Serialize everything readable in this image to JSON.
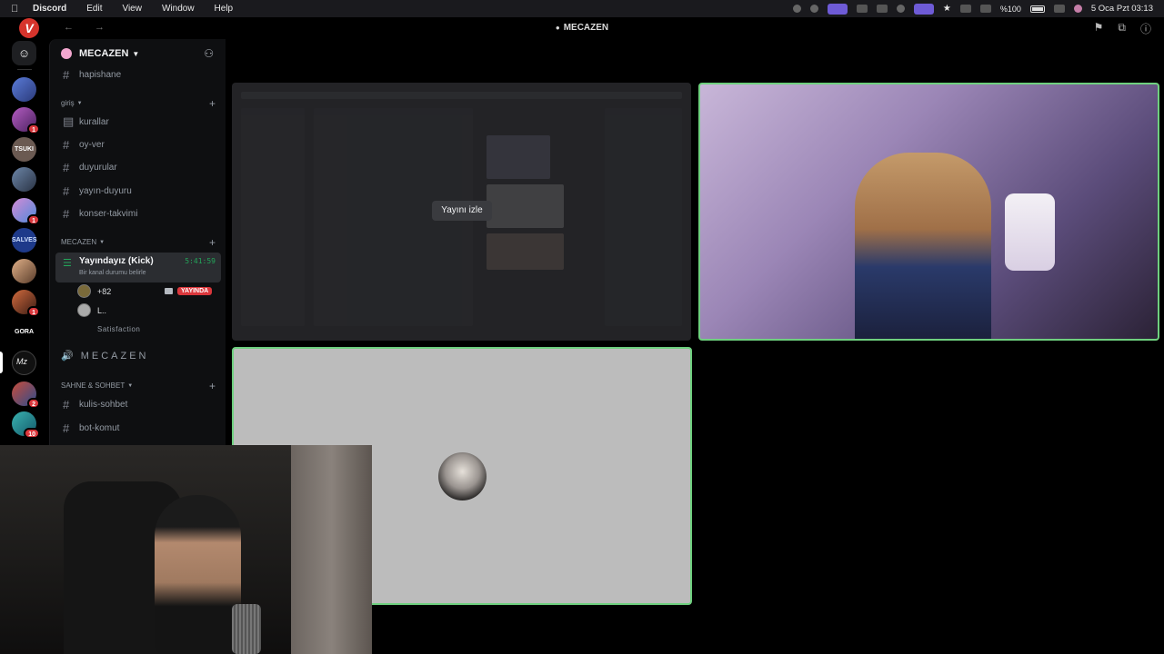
{
  "menubar": {
    "app": "Discord",
    "items": [
      "Edit",
      "View",
      "Window",
      "Help"
    ],
    "battery": "%100",
    "datetime": "5 Oca Pzt  03:13"
  },
  "titlebar": {
    "title": "MECAZEN"
  },
  "rail": {
    "servers": [
      {
        "label": "",
        "badge": ""
      },
      {
        "label": "",
        "badge": "1"
      },
      {
        "label": "TSUKI",
        "badge": ""
      },
      {
        "label": "",
        "badge": ""
      },
      {
        "label": "",
        "badge": "1"
      },
      {
        "label": "SALVES",
        "badge": ""
      },
      {
        "label": "",
        "badge": ""
      },
      {
        "label": "",
        "badge": "1"
      },
      {
        "label": "GORA",
        "badge": ""
      },
      {
        "label": "",
        "badge": ""
      },
      {
        "label": "",
        "badge": "2"
      },
      {
        "label": "",
        "badge": "10"
      }
    ]
  },
  "sidebar": {
    "guild_name": "MECAZEN",
    "channels_top": [
      "hapishane"
    ],
    "category_giris": "giriş",
    "giris_channels": [
      "kurallar",
      "oy-ver",
      "duyurular",
      "yayın-duyuru",
      "konser-takvimi"
    ],
    "category_mecazen": "MECAZEN",
    "voice_channel": {
      "name": "Yayındayız (Kick)",
      "timer": "5:41:59",
      "status": "Bir kanal durumu belirle"
    },
    "voice_users": [
      {
        "name": "+82"
      },
      {
        "name": "L.."
      }
    ],
    "live_label": "YAYINDA",
    "activity": "Satisfaction",
    "stage_channel": "MECAZEN",
    "category_sahne": "SAHNE & SOHBET",
    "sahne_channels": [
      "kulis-sohbet",
      "bot-komut"
    ]
  },
  "main": {
    "watch_button": "Yayını izle"
  },
  "colors": {
    "accent_green": "#6fd07f",
    "live_red": "#da373c",
    "timer_green": "#23a55a"
  }
}
